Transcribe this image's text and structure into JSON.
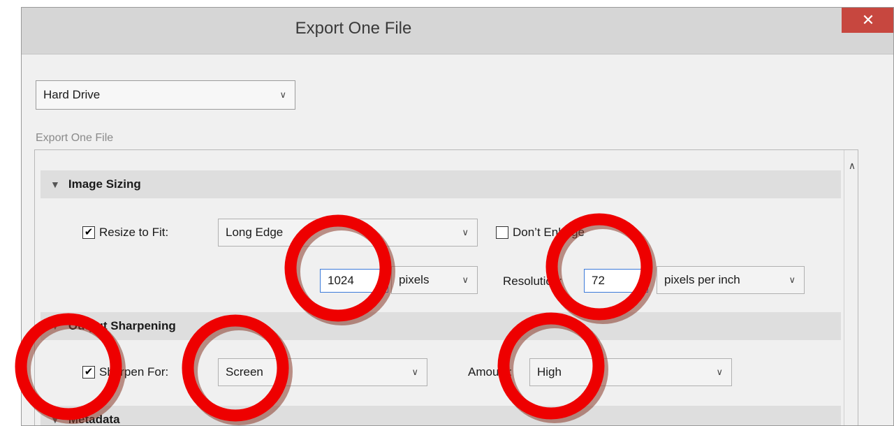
{
  "window": {
    "title": "Export One File",
    "close_glyph": "✕"
  },
  "export_to": {
    "selected": "Hard Drive"
  },
  "section_label": "Export One File",
  "image_sizing": {
    "header": "Image Sizing",
    "resize_label": "Resize to Fit:",
    "resize_checked": true,
    "resize_mode": "Long Edge",
    "dont_enlarge_label": "Don’t Enlarge",
    "dont_enlarge_checked": false,
    "size_value": "1024",
    "size_unit": "pixels",
    "resolution_label": "Resolution:",
    "resolution_value": "72",
    "resolution_unit": "pixels per inch"
  },
  "output_sharpening": {
    "header": "Output Sharpening",
    "sharpen_label": "Sharpen For:",
    "sharpen_checked": true,
    "sharpen_for": "Screen",
    "amount_label": "Amount:",
    "amount_value": "High"
  },
  "metadata": {
    "header": "Metadata"
  },
  "icons": {
    "close": "close-icon",
    "dropdown": "chevron-down-icon",
    "collapse": "triangle-down-icon",
    "scroll_up": "scroll-up-arrow-icon",
    "check": "checkmark-icon"
  },
  "colors": {
    "close_button": "#c7473f",
    "annotation_circle": "#ee0000",
    "annotation_shadow": "#8a3a2a",
    "field_focus": "#3b7ad9"
  }
}
